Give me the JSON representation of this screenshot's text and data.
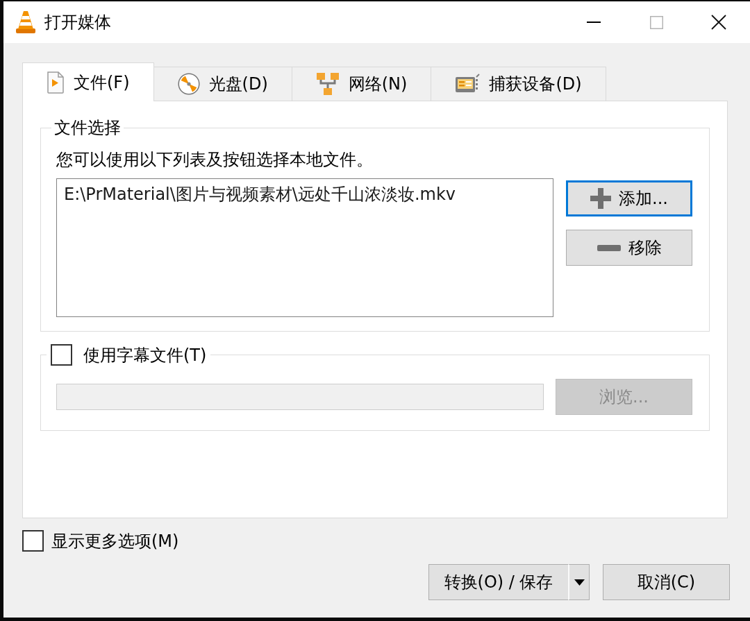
{
  "window": {
    "title": "打开媒体",
    "maximize_disabled": true
  },
  "tabs": [
    {
      "label": "文件(F)",
      "kind": "file",
      "selected": true
    },
    {
      "label": "光盘(D)",
      "kind": "disc",
      "selected": false
    },
    {
      "label": "网络(N)",
      "kind": "network",
      "selected": false
    },
    {
      "label": "捕获设备(D)",
      "kind": "capture",
      "selected": false
    }
  ],
  "file_selection": {
    "title": "文件选择",
    "description": "您可以使用以下列表及按钮选择本地文件。",
    "files": [
      "E:\\PrMaterial\\图片与视频素材\\远处千山浓淡妆.mkv"
    ],
    "buttons": [
      {
        "label": "添加...",
        "kind": "add",
        "focused": true
      },
      {
        "label": "移除",
        "kind": "remove",
        "focused": false
      }
    ]
  },
  "subtitle": {
    "label": "使用字幕文件(T)",
    "checked": false,
    "path_field": {
      "disabled": true
    },
    "browse_button": {
      "label": "浏览...",
      "disabled": true
    }
  },
  "more_options": {
    "label": "显示更多选项(M)",
    "checked": false
  },
  "actions": [
    {
      "label": "转换(O) / 保存",
      "kind": "split"
    },
    {
      "label": "取消(C)",
      "kind": "plain"
    }
  ]
}
